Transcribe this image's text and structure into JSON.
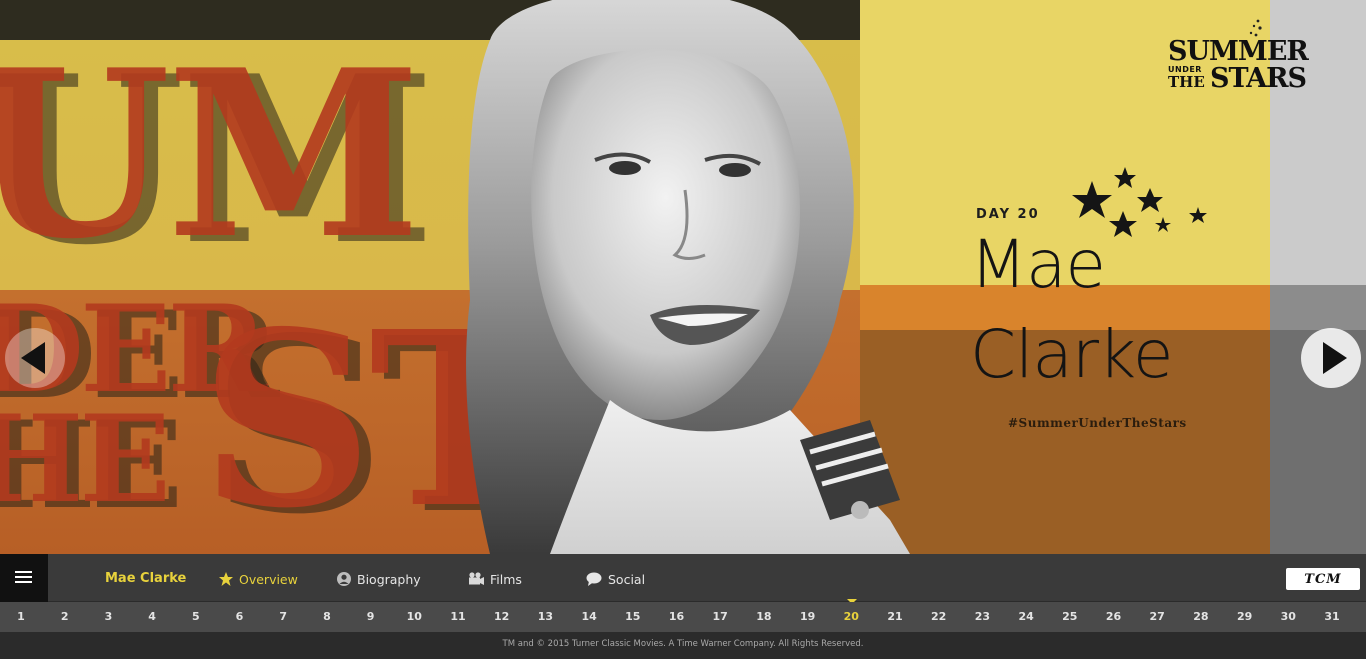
{
  "hero": {
    "backdrop_words": [
      "UM",
      "DER",
      "ST",
      "HE"
    ],
    "day_label": "DAY 20",
    "first_name": "Mae",
    "last_name": "Clarke",
    "hashtag": "#SummerUnderTheStars"
  },
  "logo": {
    "line1": "SUMMER",
    "line2": "UNDER",
    "line3": "THE",
    "line4": "STARS"
  },
  "nav": {
    "title": "Mae Clarke",
    "links": [
      {
        "label": "Overview",
        "icon": "star-icon",
        "active": true
      },
      {
        "label": "Biography",
        "icon": "person-icon",
        "active": false
      },
      {
        "label": "Films",
        "icon": "film-camera-icon",
        "active": false
      },
      {
        "label": "Social",
        "icon": "speech-bubble-icon",
        "active": false
      }
    ],
    "brand": "TCM"
  },
  "days": {
    "items": [
      "1",
      "2",
      "3",
      "4",
      "5",
      "6",
      "7",
      "8",
      "9",
      "10",
      "11",
      "12",
      "13",
      "14",
      "15",
      "16",
      "17",
      "18",
      "19",
      "20",
      "21",
      "22",
      "23",
      "24",
      "25",
      "26",
      "27",
      "28",
      "29",
      "30",
      "31"
    ],
    "active": "20"
  },
  "footer": {
    "text": "TM and © 2015 Turner Classic Movies. A Time Warner Company. All Rights Reserved."
  },
  "colors": {
    "accent": "#e8d23c",
    "nav_bg": "#3a3a3a",
    "daybar_bg": "#4a4a4a",
    "footer_bg": "#2b2b2b"
  }
}
